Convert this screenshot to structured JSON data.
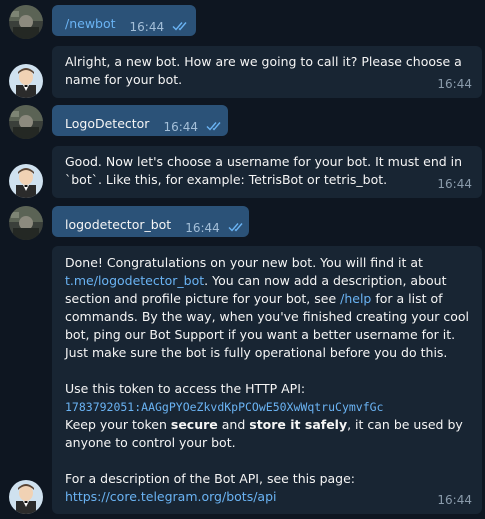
{
  "messages": [
    {
      "id": "m1",
      "direction": "out",
      "text": "/newbot",
      "time": "16:44",
      "read": true
    },
    {
      "id": "m2",
      "direction": "in",
      "text": "Alright, a new bot. How are we going to call it? Please choose a name for your bot.",
      "time": "16:44"
    },
    {
      "id": "m3",
      "direction": "out",
      "text": "LogoDetector",
      "time": "16:44",
      "read": true
    },
    {
      "id": "m4",
      "direction": "in",
      "text": "Good. Now let's choose a username for your bot. It must end in `bot`. Like this, for example: TetrisBot or tetris_bot.",
      "time": "16:44"
    },
    {
      "id": "m5",
      "direction": "out",
      "text": "logodetector_bot",
      "time": "16:44",
      "read": true
    },
    {
      "id": "m6",
      "direction": "in",
      "time": "16:44",
      "p1_a": "Done! Congratulations on your new bot. You will find it at",
      "p1_link": "t.me/logodetector_bot",
      "p1_b": ". You can now add a description, about section and profile picture for your bot, see",
      "p1_cmd": "/help",
      "p1_c": "for a list of commands. By the way, when you've finished creating your cool bot, ping our Bot Support if you want a better username for it. Just make sure the bot is fully operational before you do this.",
      "p2_a": "Use this token to access the HTTP API:",
      "p2_token": "1783792051:AAGgPYOeZkvdKpPCOwE50XwWqtruCymvfGc",
      "p2_b": "Keep your token",
      "p2_bold1": "secure",
      "p2_c": "and",
      "p2_bold2": "store it safely",
      "p2_d": ", it can be used by anyone to control your bot.",
      "p3_a": "For a description of the Bot API, see this page:",
      "p3_link": "https://core.telegram.org/bots/api"
    }
  ],
  "colors": {
    "background": "#0e1621",
    "incoming_bubble": "#182533",
    "outgoing_bubble": "#2b5278",
    "link": "#6ab3f3",
    "read_check": "#6ab3f3"
  },
  "icons": {
    "avatar_user": "user-avatar-icon",
    "avatar_bot": "botfather-avatar-icon",
    "read": "double-check-icon"
  }
}
